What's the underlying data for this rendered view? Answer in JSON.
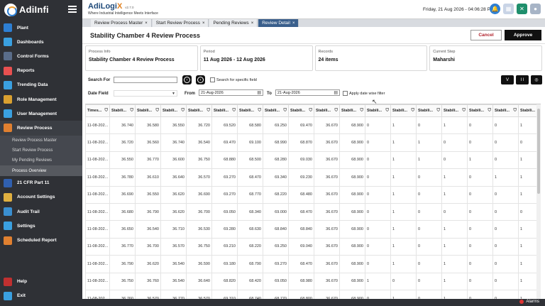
{
  "sidebar": {
    "logo_text": "AdiInfi",
    "items": [
      {
        "label": "Plant",
        "icon": "plant-icon",
        "color": "#2d7fd3"
      },
      {
        "label": "Dashboards",
        "icon": "dashboard-icon",
        "color": "#3aa0e0"
      },
      {
        "label": "Control Forms",
        "icon": "control-forms-icon",
        "color": "#5a6d8a"
      },
      {
        "label": "Reports",
        "icon": "reports-icon",
        "color": "#e85050"
      },
      {
        "label": "Trending Data",
        "icon": "trending-icon",
        "color": "#3aa0e0"
      },
      {
        "label": "Role Management",
        "icon": "role-icon",
        "color": "#d9a030"
      },
      {
        "label": "User Management",
        "icon": "user-icon",
        "color": "#3aa0e0"
      },
      {
        "label": "Review Process",
        "icon": "review-icon",
        "color": "#e08030"
      }
    ],
    "sub_items": [
      {
        "label": "Review Process Master"
      },
      {
        "label": "Start Review Process"
      },
      {
        "label": "My Pending Reviews"
      },
      {
        "label": "Process Overview"
      }
    ],
    "items_after": [
      {
        "label": "21 CFR Part 11",
        "icon": "cfr-icon",
        "color": "#3060b0"
      },
      {
        "label": "Account Settings",
        "icon": "account-settings-icon",
        "color": "#e0b040"
      },
      {
        "label": "Audit Trail",
        "icon": "audit-icon",
        "color": "#3a8fd0"
      },
      {
        "label": "Settings",
        "icon": "settings-icon",
        "color": "#3aa0e0"
      },
      {
        "label": "Scheduled Report",
        "icon": "scheduled-report-icon",
        "color": "#e08030"
      }
    ],
    "bottom": [
      {
        "label": "Help",
        "icon": "help-icon",
        "color": "#c03030"
      },
      {
        "label": "Exit",
        "icon": "exit-icon",
        "color": "#3aa0e0"
      }
    ]
  },
  "header": {
    "brand": "AdiLogi",
    "brand_x": "X",
    "version": "v2.7.0",
    "tagline": "Where Industrial Intelligence Meets Interface",
    "datetime": "Friday, 21 Aug 2026 - 04:06:28 PM"
  },
  "tabs": [
    {
      "label": "Review Process Master",
      "active": false
    },
    {
      "label": "Start Review Process",
      "active": false
    },
    {
      "label": "Pending Reviews",
      "active": false
    },
    {
      "label": "Review Detail",
      "active": true
    }
  ],
  "page": {
    "title": "Stability Chamber 4 Review Process",
    "cancel_label": "Cancel",
    "approve_label": "Approve"
  },
  "cards": [
    {
      "label": "Process Info",
      "value": "Stability Chamber 4 Review Process"
    },
    {
      "label": "Period",
      "value": "11 Aug 2026 - 12 Aug 2026"
    },
    {
      "label": "Records",
      "value": "24 items"
    },
    {
      "label": "Current Step",
      "value": "Maharshi"
    }
  ],
  "filters": {
    "search_label": "Search For",
    "search_value": "",
    "specific_field_label": "Search for specific field",
    "date_field_label": "Date Field",
    "date_field_value": "",
    "from_label": "From",
    "from_value": "21-Aug-2026",
    "to_label": "To",
    "to_value": "21-Aug-2026",
    "date_filter_label": "Apply date wise filter",
    "btn_v": "V",
    "btn_cols": "I I"
  },
  "table": {
    "columns": [
      "Times...",
      "Stabili...",
      "Stabili...",
      "Stabili...",
      "Stabili...",
      "Stabili...",
      "Stabili...",
      "Stabili...",
      "Stabili...",
      "Stabili...",
      "Stabili...",
      "Stabili...",
      "Stabili...",
      "Stabili...",
      "Stabili...",
      "Stabili...",
      "Stabili...",
      "Stabili..."
    ],
    "rows": [
      [
        "11-08-202...",
        "36.740",
        "36.580",
        "36.550",
        "36.720",
        "69.520",
        "68.580",
        "69.250",
        "69.470",
        "36.670",
        "68.900",
        "0",
        "1",
        "0",
        "1",
        "0",
        "0",
        "1"
      ],
      [
        "11-08-202...",
        "36.720",
        "36.560",
        "36.740",
        "36.540",
        "69.470",
        "69.100",
        "68.990",
        "68.870",
        "36.670",
        "68.900",
        "0",
        "1",
        "1",
        "0",
        "0",
        "0",
        "0"
      ],
      [
        "11-08-202...",
        "36.550",
        "36.770",
        "36.600",
        "36.750",
        "68.880",
        "68.500",
        "68.280",
        "69.030",
        "36.670",
        "68.900",
        "0",
        "1",
        "1",
        "0",
        "1",
        "0",
        "1"
      ],
      [
        "11-08-202...",
        "36.780",
        "36.610",
        "36.640",
        "36.570",
        "69.270",
        "68.470",
        "69.340",
        "69.230",
        "36.670",
        "68.900",
        "0",
        "1",
        "0",
        "1",
        "0",
        "1",
        "1"
      ],
      [
        "11-08-202...",
        "36.690",
        "36.550",
        "36.620",
        "36.690",
        "69.270",
        "68.770",
        "68.220",
        "68.480",
        "36.670",
        "68.900",
        "0",
        "1",
        "0",
        "1",
        "0",
        "0",
        "1"
      ],
      [
        "11-08-202...",
        "36.680",
        "36.790",
        "36.620",
        "36.700",
        "69.050",
        "68.340",
        "69.000",
        "68.470",
        "36.670",
        "68.900",
        "0",
        "1",
        "0",
        "0",
        "0",
        "0",
        "0"
      ],
      [
        "11-08-202...",
        "36.650",
        "36.540",
        "36.710",
        "36.530",
        "69.280",
        "68.630",
        "68.840",
        "68.840",
        "36.670",
        "68.900",
        "0",
        "1",
        "0",
        "1",
        "0",
        "0",
        "1"
      ],
      [
        "11-08-202...",
        "36.770",
        "36.700",
        "36.570",
        "36.750",
        "69.210",
        "68.220",
        "69.250",
        "69.040",
        "36.670",
        "68.900",
        "0",
        "1",
        "0",
        "1",
        "0",
        "0",
        "1"
      ],
      [
        "11-08-202...",
        "36.790",
        "36.620",
        "36.540",
        "36.590",
        "69.180",
        "68.790",
        "69.270",
        "68.470",
        "36.670",
        "68.900",
        "0",
        "1",
        "0",
        "1",
        "0",
        "0",
        "1"
      ],
      [
        "11-08-202...",
        "36.750",
        "36.760",
        "36.540",
        "36.640",
        "68.820",
        "68.420",
        "69.050",
        "68.980",
        "36.670",
        "68.900",
        "1",
        "0",
        "0",
        "1",
        "0",
        "0",
        "1"
      ],
      [
        "11-08-202...",
        "36.760",
        "36.570",
        "36.770",
        "36.570",
        "69.310",
        "68.740",
        "68.770",
        "68.800",
        "36.670",
        "68.900",
        "0",
        "1",
        "0",
        "1",
        "0",
        "0",
        "1"
      ]
    ]
  },
  "footer": {
    "alarms_label": "Alarms"
  },
  "colors": {
    "sidebar_bg": "#2f3136",
    "active_tab": "#3a5f8c",
    "cancel_text": "#b0202a",
    "approve_bg": "#111111"
  }
}
